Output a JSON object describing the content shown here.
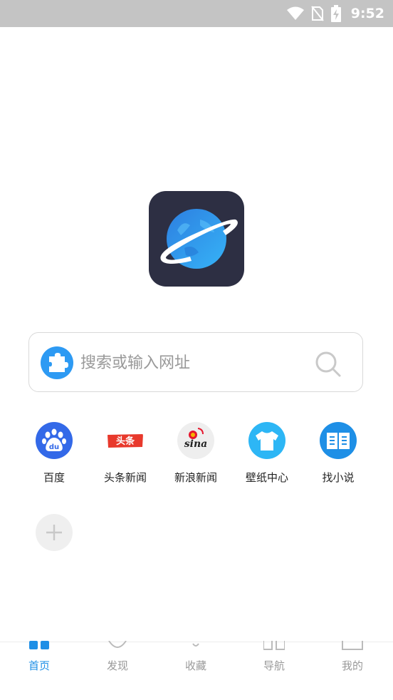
{
  "status_bar": {
    "time": "9:52",
    "icons": [
      "wifi-icon",
      "no-sim-icon",
      "battery-charging-icon"
    ]
  },
  "logo": {
    "name": "planet-logo-icon"
  },
  "search": {
    "placeholder": "搜索或输入网址",
    "value": "",
    "badge_icon": "puzzle-icon",
    "icon": "search-icon"
  },
  "shortcuts": [
    {
      "label": "百度",
      "icon": "baidu-icon",
      "color": "#3369e8"
    },
    {
      "label": "头条新闻",
      "icon": "toutiao-icon",
      "color": "#e8392c"
    },
    {
      "label": "新浪新闻",
      "icon": "sina-icon",
      "color": "#e6162d"
    },
    {
      "label": "壁纸中心",
      "icon": "tshirt-icon",
      "color": "#2db6f5"
    },
    {
      "label": "找小说",
      "icon": "book-icon",
      "color": "#1e8fe6"
    }
  ],
  "add_shortcut": {
    "icon": "plus-icon"
  },
  "tabbar": {
    "active": 0,
    "accent": "#1e8fe6",
    "items": [
      {
        "label": "首页",
        "icon": "home-icon"
      },
      {
        "label": "发现",
        "icon": "discover-icon"
      },
      {
        "label": "收藏",
        "icon": "favorites-icon"
      },
      {
        "label": "导航",
        "icon": "navigation-icon"
      },
      {
        "label": "我的",
        "icon": "profile-icon"
      }
    ]
  }
}
